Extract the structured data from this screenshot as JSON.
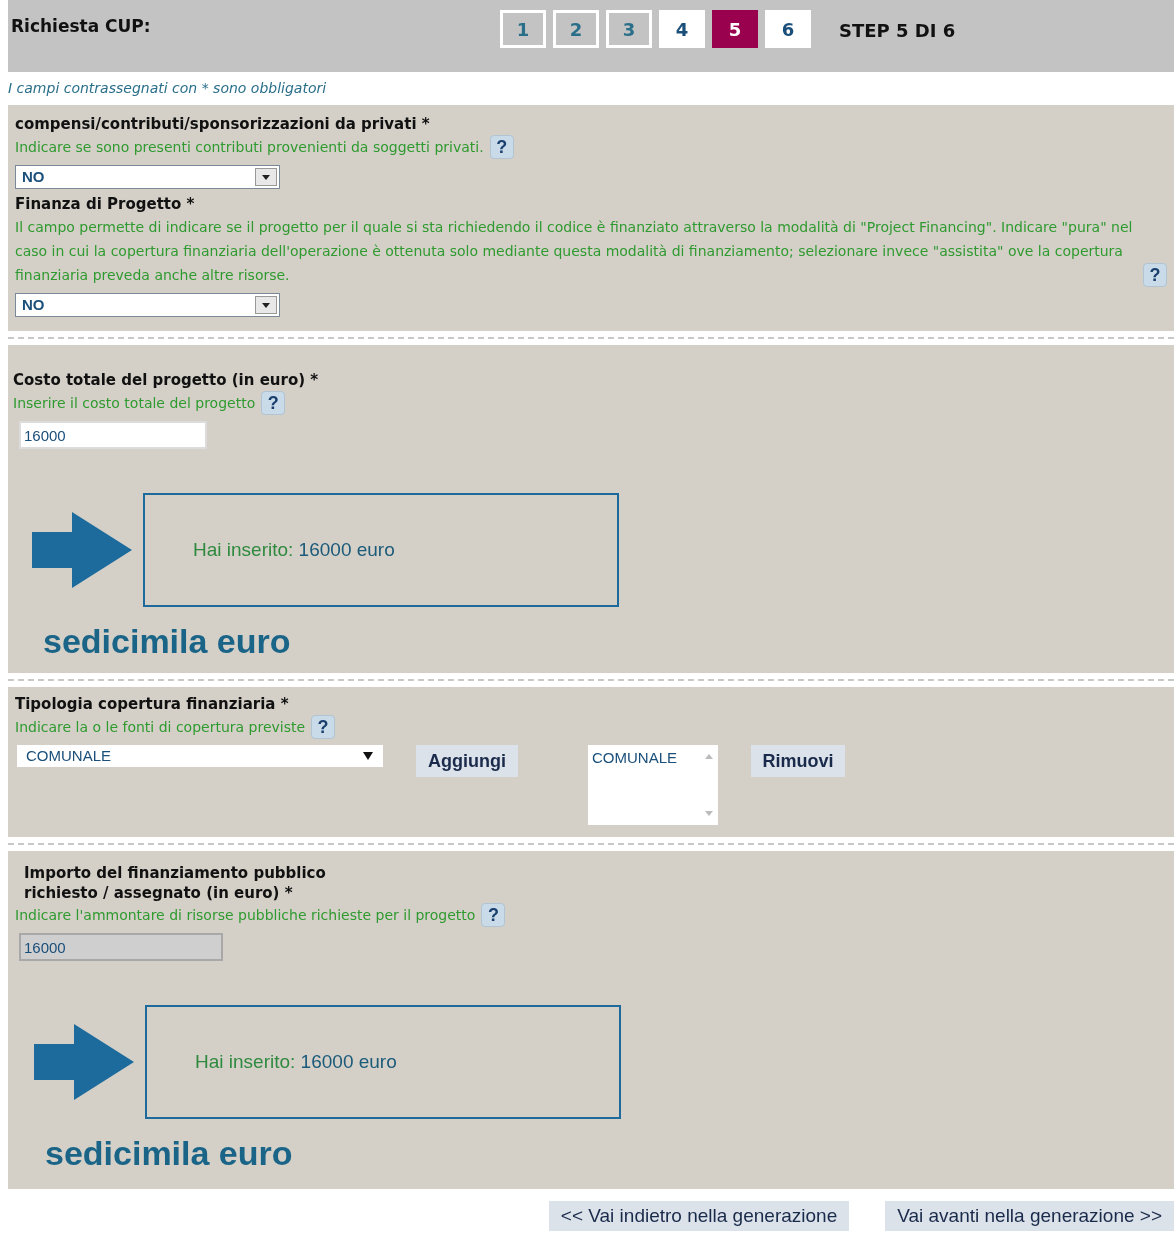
{
  "header": {
    "title": "Richiesta CUP:",
    "steps": [
      {
        "label": "1",
        "selected": false,
        "done": true
      },
      {
        "label": "2",
        "selected": false,
        "done": true
      },
      {
        "label": "3",
        "selected": false,
        "done": true
      },
      {
        "label": "4",
        "selected": false,
        "done": false
      },
      {
        "label": "5",
        "selected": true,
        "done": false
      },
      {
        "label": "6",
        "selected": false,
        "done": false
      }
    ],
    "step_text": "STEP 5 DI 6"
  },
  "note": "I campi contrassegnati con * sono obbligatori",
  "privati": {
    "label": "compensi/contributi/sponsorizzazioni da privati *",
    "help": "Indicare se sono presenti contributi provenienti da soggetti privati.",
    "help_button": "?",
    "value": "NO"
  },
  "finanza": {
    "label": "Finanza di Progetto *",
    "help": "Il campo permette di indicare se il progetto per il quale si sta richiedendo il codice è finanziato attraverso la modalità di \"Project Financing\". Indicare \"pura\" nel caso in cui la copertura finanziaria dell'operazione è ottenuta solo mediante questa modalità di finanziamento; selezionare invece \"assistita\" ove la copertura finanziaria preveda anche altre risorse.",
    "help_button": "?",
    "value": "NO"
  },
  "costo": {
    "label": "Costo totale del progetto (in euro) *",
    "help": "Inserire il costo totale del progetto",
    "help_button": "?",
    "value": "16000",
    "disabled": false,
    "echo_prefix": "Hai inserito:",
    "echo_value": "16000 euro",
    "words": "sedicimila euro"
  },
  "tipologia": {
    "label": "Tipologia copertura finanziaria *",
    "help": "Indicare la o le fonti di copertura previste",
    "help_button": "?",
    "value": "COMUNALE",
    "add_button": "Aggiungi",
    "chosen": [
      "COMUNALE"
    ],
    "remove_button": "Rimuovi"
  },
  "importo": {
    "label_lines": [
      "Importo del finanziamento pubblico",
      "richiesto / assegnato (in euro) *"
    ],
    "help": "Indicare l'ammontare di risorse pubbliche richieste per il progetto",
    "help_button": "?",
    "value": "16000",
    "disabled": true,
    "echo_prefix": "Hai inserito:",
    "echo_value": "16000 euro",
    "words": "sedicimila euro"
  },
  "nav": {
    "back": "<< Vai indietro nella generazione",
    "forward": "Vai avanti nella generazione >>"
  }
}
